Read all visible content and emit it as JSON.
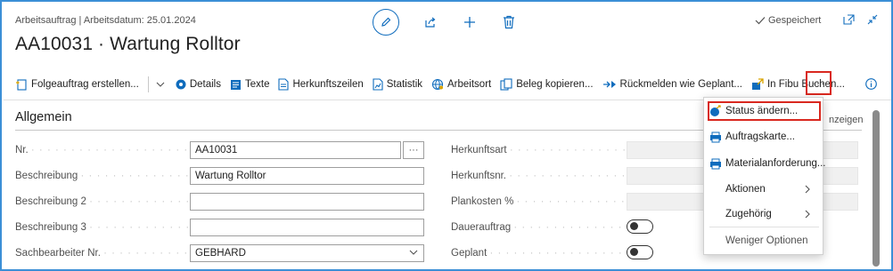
{
  "header": {
    "breadcrumb": "Arbeitsauftrag | Arbeitsdatum: 25.01.2024",
    "title": "AA10031 · Wartung Rolltor",
    "saved_label": "Gespeichert"
  },
  "actionbar": {
    "items": [
      {
        "label": "Folgeauftrag erstellen...",
        "icon": "follow-order-icon"
      },
      {
        "label": "Details",
        "icon": "details-icon"
      },
      {
        "label": "Texte",
        "icon": "texts-icon"
      },
      {
        "label": "Herkunftszeilen",
        "icon": "origin-lines-icon"
      },
      {
        "label": "Statistik",
        "icon": "statistics-icon"
      },
      {
        "label": "Arbeitsort",
        "icon": "work-location-icon"
      },
      {
        "label": "Beleg kopieren...",
        "icon": "copy-document-icon"
      },
      {
        "label": "Rückmelden wie Geplant...",
        "icon": "report-back-icon"
      },
      {
        "label": "In Fibu Buchen...",
        "icon": "post-finance-icon"
      }
    ],
    "more_label": "···"
  },
  "section": {
    "title": "Allgemein",
    "show_more_partial": "nzeigen"
  },
  "fields_left": [
    {
      "label": "Nr.",
      "value": "AA10031"
    },
    {
      "label": "Beschreibung",
      "value": "Wartung Rolltor"
    },
    {
      "label": "Beschreibung 2",
      "value": ""
    },
    {
      "label": "Beschreibung 3",
      "value": ""
    },
    {
      "label": "Sachbearbeiter Nr.",
      "value": "GEBHARD"
    }
  ],
  "fields_right": [
    {
      "label": "Herkunftsart",
      "value": ""
    },
    {
      "label": "Herkunftsnr.",
      "value": ""
    },
    {
      "label": "Plankosten %",
      "value": ""
    },
    {
      "label": "Dauerauftrag",
      "toggle": false
    },
    {
      "label": "Geplant",
      "toggle": false
    }
  ],
  "menu": {
    "items": [
      {
        "label": "Status ändern...",
        "icon": "status-change-icon",
        "highlighted": true
      },
      {
        "label": "Auftragskarte...",
        "icon": "printer-icon"
      },
      {
        "label": "Materialanforderung...",
        "icon": "printer-icon"
      },
      {
        "label": "Aktionen",
        "submenu": true
      },
      {
        "label": "Zugehörig",
        "submenu": true
      }
    ],
    "less_options": "Weniger Optionen"
  },
  "colors": {
    "accent": "#0f6cbd",
    "highlight_border": "#d9281f",
    "frame_border": "#3b8fd6"
  }
}
